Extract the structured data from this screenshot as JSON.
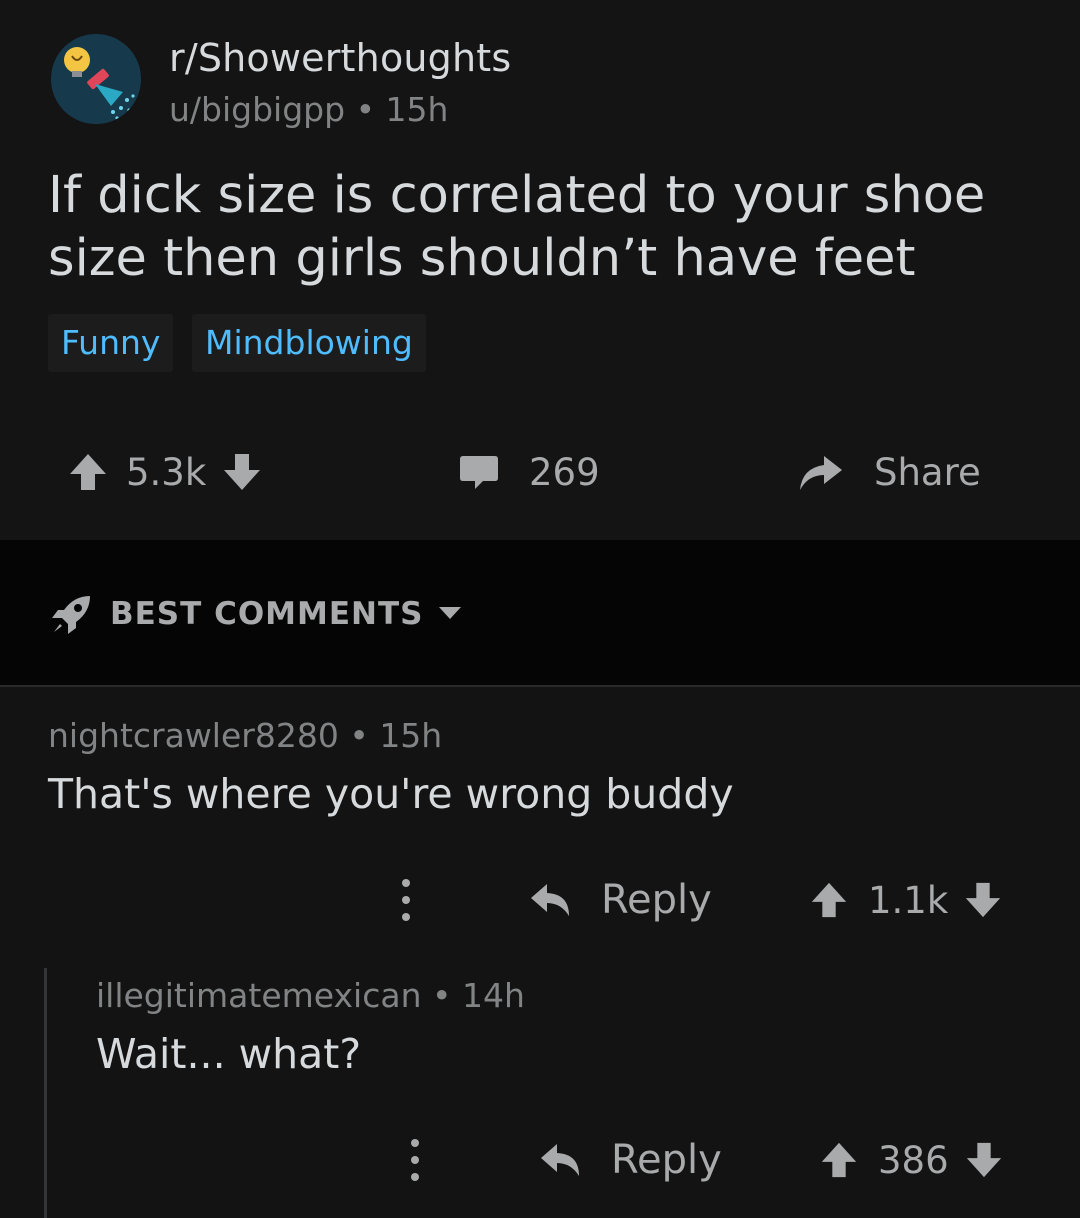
{
  "post": {
    "subreddit": "r/Showerthoughts",
    "author": "u/bigbigpp",
    "age": "15h",
    "title": "If dick size is correlated to your shoe size then girls shouldn’t have feet",
    "flairs": [
      "Funny",
      "Mindblowing"
    ],
    "score": "5.3k",
    "comment_count": "269",
    "share_label": "Share",
    "avatar_icon": "shower-lightbulb-icon"
  },
  "sort": {
    "label": "BEST COMMENTS",
    "icon": "rocket-icon"
  },
  "comments": [
    {
      "author": "nightcrawler8280",
      "age": "15h",
      "body": "That's where you're wrong buddy",
      "reply_label": "Reply",
      "score": "1.1k"
    },
    {
      "author": "illegitimatemexican",
      "age": "14h",
      "body": "Wait... what?",
      "reply_label": "Reply",
      "score": "386"
    }
  ],
  "meta_separator": "•",
  "colors": {
    "background": "#131313",
    "sort_bar": "#050505",
    "flair_text": "#4fbcff",
    "flair_bg": "#1c1c1c",
    "text_primary": "#d7dadc",
    "text_muted": "#818384",
    "icon": "#a8aaab"
  }
}
